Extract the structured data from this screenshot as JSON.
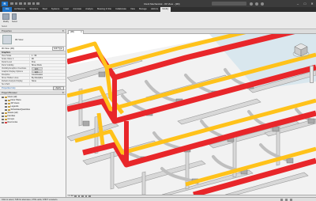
{
  "window": {
    "app_badge": "R",
    "title": "Revit Mechanical - 3D View - {3D}",
    "controls": [
      "–",
      "□",
      "✕"
    ]
  },
  "ribbon": {
    "tabs": [
      "File",
      "Architecture",
      "Structure",
      "Steel",
      "Systems",
      "Insert",
      "Annotate",
      "Analyze",
      "Massing & Site",
      "Collaborate",
      "View",
      "Manage",
      "Add-Ins",
      "Modify"
    ],
    "active_tab": "Modify",
    "buttons": [
      "Modify",
      "Select"
    ],
    "group_label": "Select"
  },
  "properties": {
    "title": "Properties",
    "close": "✕",
    "type_name": "3D View",
    "selector_label": "3D View: {3D}",
    "edit_type": "Edit Type",
    "section": "Graphics",
    "rows": [
      {
        "k": "View Scale",
        "v": "1 : 96"
      },
      {
        "k": "Scale Value 1:",
        "v": "96"
      },
      {
        "k": "Detail Level",
        "v": "Fine"
      },
      {
        "k": "Parts Visibility",
        "v": "Show Parts"
      },
      {
        "k": "Visibility/Graphics Overrides",
        "v": "Edit...",
        "btn": true
      },
      {
        "k": "Graphic Display Options",
        "v": "Edit...",
        "btn": true
      },
      {
        "k": "Discipline",
        "v": "Coordination"
      },
      {
        "k": "Show Hidden Lines",
        "v": "By Discipline"
      },
      {
        "k": "Default Analysis Display",
        "v": "None"
      },
      {
        "k": "Sun Path",
        "v": ""
      }
    ],
    "help_link": "Properties help",
    "apply": "Apply"
  },
  "browser": {
    "title": "Project Browser",
    "close": "✕",
    "nodes": [
      {
        "label": "Views (all)",
        "level": 0,
        "open": true
      },
      {
        "label": "Floor Plans",
        "level": 1
      },
      {
        "label": "3D Views",
        "level": 1
      },
      {
        "label": "Legends",
        "level": 1
      },
      {
        "label": "Schedules/Quantities",
        "level": 1
      },
      {
        "label": "Sheets (all)",
        "level": 0
      },
      {
        "label": "Families",
        "level": 0
      },
      {
        "label": "Groups",
        "level": 0
      },
      {
        "label": "Revit Links",
        "level": 0,
        "red": true
      }
    ]
  },
  "view": {
    "tab_label": "{3D}",
    "tab_close": "✕",
    "scale": "1 : 96"
  },
  "status": {
    "text": "Click to select, TAB for alternates, CTRL adds, SHIFT unselects."
  },
  "colors": {
    "duct_red": "#e8262a",
    "duct_yellow": "#ffc21a",
    "duct_gray": "#c7c7c7",
    "wall_gray": "#d8d8d8",
    "brand": "#1e73c8"
  }
}
